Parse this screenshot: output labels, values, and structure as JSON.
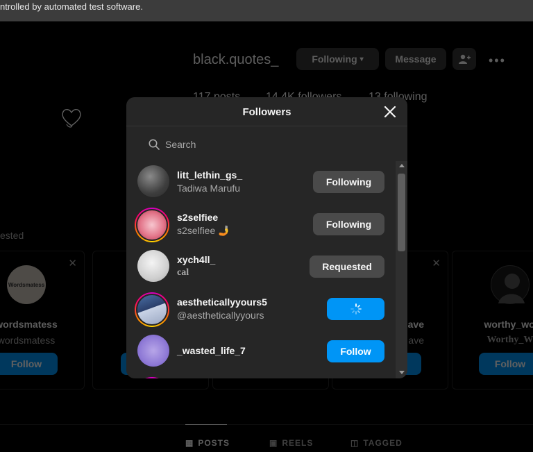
{
  "browser": {
    "infobar_text": "ntrolled by automated test software."
  },
  "profile": {
    "username": "black.quotes_",
    "following_button": "Following",
    "message_button": "Message",
    "posts": "117 posts",
    "followers": "14.4K followers",
    "following": "13 following",
    "suggested_label": "ested"
  },
  "suggested_cards": [
    {
      "name": "wordsmatess",
      "sub": "wordsmatess",
      "avatar_text": "Wordsmatess",
      "follow": "Follow"
    },
    {
      "name": "",
      "sub": "",
      "follow": ""
    },
    {
      "name": "",
      "sub": "",
      "follow": ""
    },
    {
      "name": "ave",
      "sub": "ave",
      "follow": ""
    },
    {
      "name": "worthy_words",
      "sub": "Worthy_Word",
      "follow": "Follow"
    }
  ],
  "tabs": [
    "POSTS",
    "REELS",
    "TAGGED"
  ],
  "modal": {
    "title": "Followers",
    "search_placeholder": "Search",
    "rows": [
      {
        "username": "litt_lethin_gs_",
        "fullname": "Tadiwa Marufu",
        "button": "Following",
        "button_style": "grey"
      },
      {
        "username": "s2selfiee",
        "fullname": "s2selfiee 🤳",
        "button": "Following",
        "button_style": "grey"
      },
      {
        "username": "xych4ll_",
        "fullname": "cal",
        "button": "Requested",
        "button_style": "grey"
      },
      {
        "username": "aestheticallyyours5",
        "fullname": "@aestheticallyyours",
        "button": "",
        "button_style": "blue-loading"
      },
      {
        "username": "_wasted_life_7",
        "fullname": "",
        "button": "Follow",
        "button_style": "blue"
      }
    ]
  },
  "colors": {
    "accent": "#0095f6",
    "modal_bg": "#262626",
    "button_grey": "#4a4a4a"
  }
}
